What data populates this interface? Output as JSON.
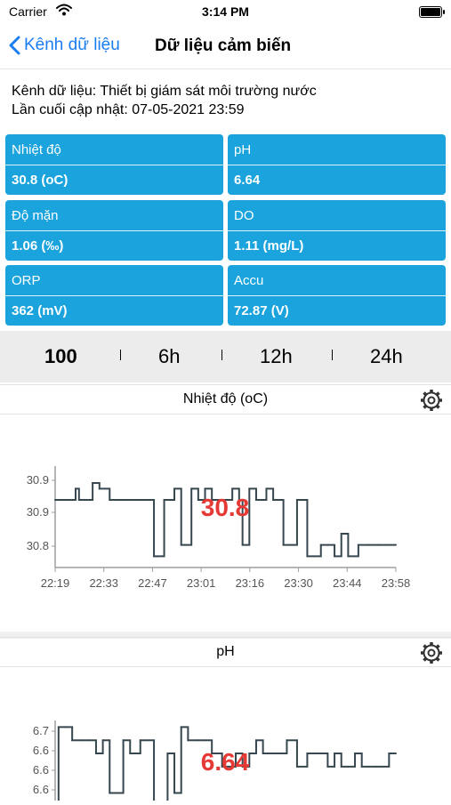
{
  "status_bar": {
    "carrier": "Carrier",
    "time": "3:14 PM"
  },
  "nav": {
    "back_label": "Kênh dữ liệu",
    "title": "Dữ liệu cảm biến"
  },
  "info": {
    "channel_line": "Kênh dữ liệu: Thiết bị giám sát môi trường nước",
    "updated_line": "Lần cuối cập nhật: 07-05-2021 23:59"
  },
  "tiles": [
    {
      "label": "Nhiệt độ",
      "value": "30.8 (oC)"
    },
    {
      "label": "pH",
      "value": "6.64"
    },
    {
      "label": "Độ mặn",
      "value": "1.06 (‰)"
    },
    {
      "label": "DO",
      "value": "1.11 (mg/L)"
    },
    {
      "label": "ORP",
      "value": "362 (mV)"
    },
    {
      "label": "Accu",
      "value": "72.87 (V)"
    }
  ],
  "range": {
    "options": [
      "100",
      "6h",
      "12h",
      "24h"
    ],
    "selected": "100"
  },
  "colors": {
    "accent": "#1a7df0",
    "tile": "#1aa3dc",
    "current_value": "#e53935",
    "line": "#37474f"
  },
  "chart_data": [
    {
      "type": "line",
      "title": "Nhiệt độ (oC)",
      "current_label": "30.8",
      "x_ticks": [
        "22:19",
        "22:33",
        "22:47",
        "23:01",
        "23:16",
        "23:30",
        "23:44",
        "23:58"
      ],
      "y_ticks": [
        "30.9",
        "30.9",
        "30.8"
      ],
      "ylim": [
        30.76,
        30.94
      ],
      "x": [
        0,
        2,
        4,
        6,
        7,
        9,
        11,
        13,
        16,
        18,
        20,
        21,
        24,
        25,
        27,
        29,
        30,
        32,
        34,
        35,
        37,
        38,
        40,
        42,
        44,
        46,
        48,
        50,
        52,
        54,
        55,
        57,
        59,
        61,
        62,
        64,
        66,
        67,
        69,
        71,
        73,
        74,
        76,
        78,
        80,
        82,
        84,
        86,
        89,
        92,
        95,
        98,
        100
      ],
      "values": [
        30.88,
        30.88,
        30.88,
        30.9,
        30.88,
        30.88,
        30.91,
        30.9,
        30.88,
        30.88,
        30.88,
        30.88,
        30.88,
        30.88,
        30.88,
        30.78,
        30.78,
        30.88,
        30.88,
        30.9,
        30.8,
        30.8,
        30.9,
        30.88,
        30.9,
        30.88,
        30.88,
        30.88,
        30.9,
        30.88,
        30.8,
        30.9,
        30.88,
        30.88,
        30.9,
        30.88,
        30.88,
        30.8,
        30.8,
        30.88,
        30.88,
        30.78,
        30.78,
        30.8,
        30.8,
        30.78,
        30.82,
        30.78,
        30.8,
        30.8,
        30.8,
        30.8,
        30.8
      ]
    },
    {
      "type": "line",
      "title": "pH",
      "current_label": "6.64",
      "y_ticks": [
        "6.7",
        "6.6",
        "6.6",
        "6.6"
      ],
      "ylim": [
        6.575,
        6.71
      ],
      "x": [
        0,
        1,
        3,
        5,
        8,
        10,
        12,
        14,
        16,
        18,
        20,
        22,
        25,
        27,
        29,
        31,
        33,
        35,
        37,
        39,
        42,
        44,
        46,
        49,
        51,
        53,
        55,
        57,
        59,
        61,
        64,
        66,
        68,
        71,
        74,
        77,
        80,
        82,
        84,
        86,
        88,
        90,
        92,
        94,
        96,
        98,
        100
      ],
      "values": [
        6.57,
        6.7,
        6.7,
        6.68,
        6.68,
        6.68,
        6.66,
        6.68,
        6.6,
        6.6,
        6.68,
        6.66,
        6.68,
        6.68,
        6.58,
        6.58,
        6.66,
        6.6,
        6.7,
        6.68,
        6.68,
        6.68,
        6.66,
        6.64,
        6.64,
        6.66,
        6.64,
        6.66,
        6.68,
        6.66,
        6.66,
        6.66,
        6.68,
        6.64,
        6.66,
        6.66,
        6.64,
        6.66,
        6.64,
        6.64,
        6.66,
        6.64,
        6.64,
        6.64,
        6.64,
        6.66,
        6.66
      ]
    }
  ]
}
